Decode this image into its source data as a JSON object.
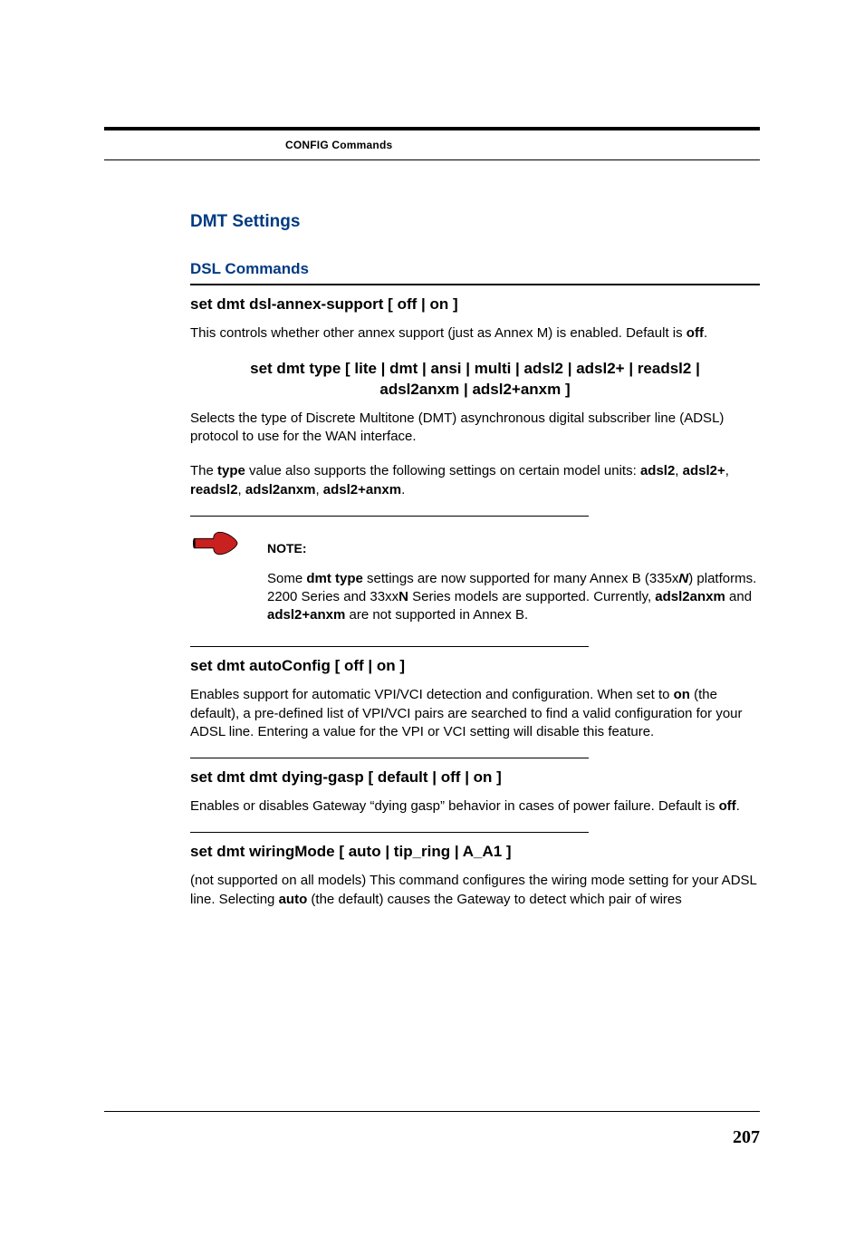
{
  "header": {
    "title": "CONFIG Commands"
  },
  "section": {
    "title": "DMT Settings",
    "subtitle": "DSL Commands"
  },
  "cmd1": {
    "title": "set dmt dsl-annex-support [ off | on ]",
    "para_pre": "This controls whether other annex support (just as Annex M) is enabled. Default is ",
    "para_bold": "off",
    "para_post": "."
  },
  "cmd2": {
    "title_l1": "set dmt type [ lite | dmt | ansi | multi | adsl2 | adsl2+ | readsl2 |",
    "title_l2": "adsl2anxm | adsl2+anxm ]",
    "para1": "Selects the type of Discrete Multitone (DMT) asynchronous digital subscriber line (ADSL) protocol to use for the WAN interface.",
    "para2_pre": "The ",
    "para2_b1": "type",
    "para2_mid": " value also supports the following settings on certain model units: ",
    "para2_b2": "adsl2",
    "para2_s2": ", ",
    "para2_b3": "adsl2+",
    "para2_s3": ", ",
    "para2_b4": "readsl2",
    "para2_s4": ", ",
    "para2_b5": "adsl2anxm",
    "para2_s5": ", ",
    "para2_b6": "adsl2+anxm",
    "para2_post": "."
  },
  "note": {
    "label": "NOTE:",
    "t1": "Some ",
    "b1": "dmt type",
    "t2": " settings are now supported for many Annex B (335x",
    "bi1": "N",
    "t3": ") platforms. 2200 Series and 33xx",
    "b2": "N",
    "t4": " Series models are supported. Currently, ",
    "b3": "adsl2anxm",
    "t5": " and ",
    "b4": "adsl2+anxm",
    "t6": " are not supported in Annex B."
  },
  "cmd3": {
    "title": "set dmt autoConfig [ off | on ]",
    "p_pre": "Enables support for automatic VPI/VCI detection and configuration. When set to ",
    "p_b1": "on",
    "p_post": " (the default), a pre-defined list of VPI/VCI pairs are searched to find a valid configuration for your ADSL line. Entering a value for the VPI or VCI setting will disable this feature."
  },
  "cmd4": {
    "title": "set dmt dmt dying-gasp [ default | off | on ]",
    "p_pre": "Enables or disables Gateway “dying gasp” behavior in cases of power failure. Default is ",
    "p_b1": "off",
    "p_post": "."
  },
  "cmd5": {
    "title": "set dmt wiringMode [ auto | tip_ring | A_A1 ]",
    "p_pre": "(not supported on all models) This command configures the wiring mode setting for your ADSL line. Selecting ",
    "p_b1": "auto",
    "p_post": " (the default) causes the Gateway to detect which pair of wires"
  },
  "page_number": "207"
}
